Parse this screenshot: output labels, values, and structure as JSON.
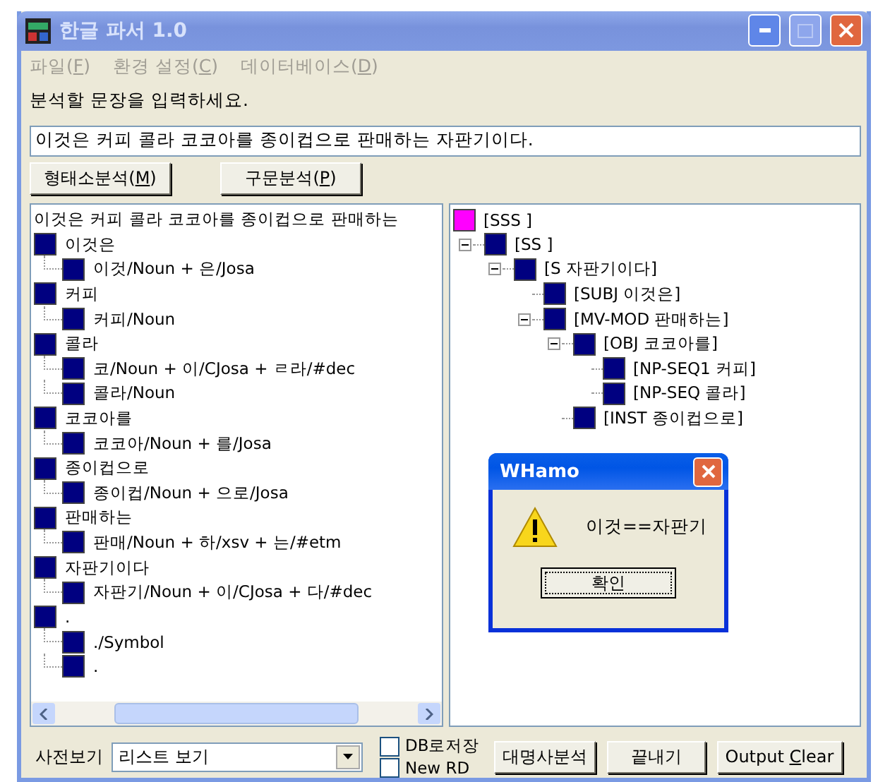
{
  "window": {
    "title": "한글 파서 1.0"
  },
  "menu": [
    {
      "before": "파일(",
      "key": "F",
      "after": ")"
    },
    {
      "before": "환경 설정(",
      "key": "C",
      "after": ")"
    },
    {
      "before": "데이터베이스(",
      "key": "D",
      "after": ")"
    }
  ],
  "prompt": "분석할 문장을 입력하세요.",
  "sentence_input": {
    "value": "이것은 커피 콜라 코코아를 종이컵으로 판매하는 자판기이다."
  },
  "analysis_buttons": [
    {
      "before": "형태소분석(",
      "key": "M",
      "after": ")"
    },
    {
      "before": "구문분석(",
      "key": "P",
      "after": ")"
    }
  ],
  "morph_tree": {
    "root": "이것은 커피 콜라 코코아를 종이컵으로 판매하는",
    "items": [
      {
        "label": "이것은",
        "children": [
          {
            "label": "이것/Noun + 은/Josa"
          }
        ]
      },
      {
        "label": "커피",
        "children": [
          {
            "label": "커피/Noun"
          }
        ]
      },
      {
        "label": "콜라",
        "children": [
          {
            "label": "코/Noun + 이/CJosa + ㄹ라/#dec"
          },
          {
            "label": "콜라/Noun"
          }
        ]
      },
      {
        "label": "코코아를",
        "children": [
          {
            "label": "코코아/Noun + 를/Josa"
          }
        ]
      },
      {
        "label": "종이컵으로",
        "children": [
          {
            "label": "종이컵/Noun + 으로/Josa"
          }
        ]
      },
      {
        "label": "판매하는",
        "children": [
          {
            "label": "판매/Noun + 하/xsv + 는/#etm"
          }
        ]
      },
      {
        "label": "자판기이다",
        "children": [
          {
            "label": "자판기/Noun + 이/CJosa + 다/#dec"
          }
        ]
      },
      {
        "label": ".",
        "children": [
          {
            "label": "./Symbol"
          },
          {
            "label": "."
          }
        ]
      }
    ]
  },
  "parse_tree": [
    {
      "label": "[SSS ]",
      "color": "#ff00ff",
      "children": [
        {
          "label": "[SS ]",
          "color": "#000080",
          "expanded": true,
          "children": [
            {
              "label": "[S 자판기이다]",
              "color": "#000080",
              "expanded": true,
              "children": [
                {
                  "label": "[SUBJ 이것은]",
                  "color": "#000080"
                },
                {
                  "label": "[MV-MOD 판매하는]",
                  "color": "#000080",
                  "expanded": true,
                  "children": [
                    {
                      "label": "[OBJ 코코아를]",
                      "color": "#000080",
                      "expanded": true,
                      "children": [
                        {
                          "label": "[NP-SEQ1 커피]",
                          "color": "#000080"
                        },
                        {
                          "label": "[NP-SEQ 콜라]",
                          "color": "#000080"
                        }
                      ]
                    },
                    {
                      "label": "[INST 종이컵으로]",
                      "color": "#000080"
                    }
                  ]
                }
              ]
            }
          ]
        }
      ]
    }
  ],
  "dialog": {
    "title": "WHamo",
    "message": "이것==자판기",
    "button": "확인"
  },
  "footer": {
    "dictionary_label": "사전보기",
    "dictionary_select": "리스트 보기",
    "checkboxes": [
      {
        "label": "DB로저장",
        "checked": false
      },
      {
        "label": "New RD",
        "checked": false
      }
    ],
    "buttons": [
      {
        "before": "대명사분석"
      },
      {
        "before": "끝내기"
      },
      {
        "before": "Output ",
        "key": "C",
        "after": "lear"
      }
    ]
  }
}
